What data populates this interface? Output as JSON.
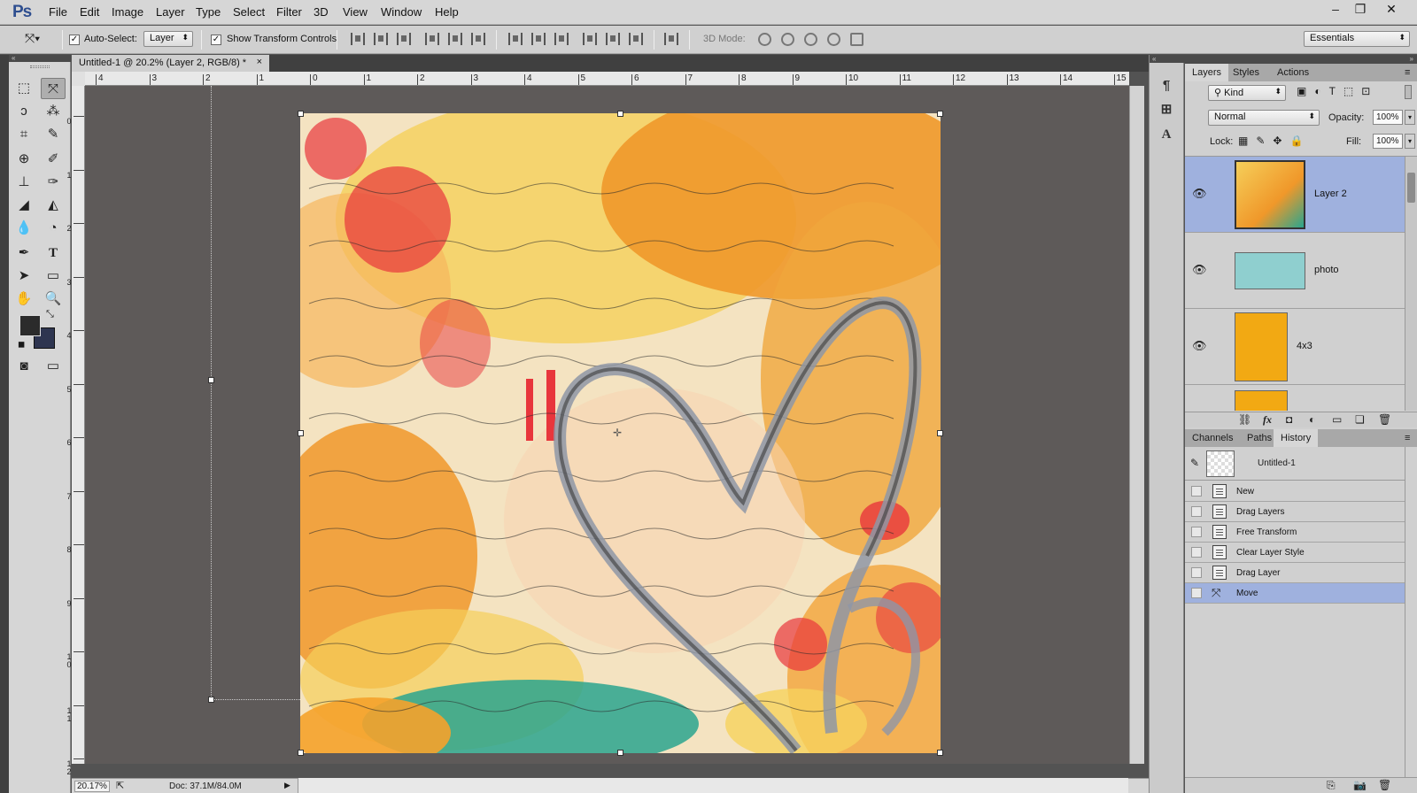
{
  "app": {
    "logo": "Ps"
  },
  "menu": [
    "File",
    "Edit",
    "Image",
    "Layer",
    "Type",
    "Select",
    "Filter",
    "3D",
    "View",
    "Window",
    "Help"
  ],
  "window_controls": {
    "minimize": "–",
    "restore": "❐",
    "close": "✕"
  },
  "options_bar": {
    "auto_select_label": "Auto-Select:",
    "auto_select_checked": true,
    "auto_select_target": "Layer",
    "show_transform_label": "Show Transform Controls",
    "show_transform_checked": true,
    "mode_3d_label": "3D Mode:",
    "workspace": "Essentials"
  },
  "document": {
    "tab_title": "Untitled-1 @ 20.2% (Layer 2, RGB/8) *",
    "tab_close": "×",
    "zoom": "20.17%",
    "doc_size": "Doc: 37.1M/84.0M"
  },
  "ruler": {
    "h_labels": [
      "4",
      "3",
      "2",
      "1",
      "0",
      "1",
      "2",
      "3",
      "4",
      "5",
      "6",
      "7",
      "8",
      "9",
      "10",
      "11",
      "12",
      "13",
      "14",
      "15"
    ],
    "v_labels": [
      "0",
      "1",
      "2",
      "3",
      "4",
      "5",
      "6",
      "7",
      "8",
      "9",
      "1\n0",
      "1\n1",
      "1\n2"
    ]
  },
  "layers_panel": {
    "tabs": [
      "Layers",
      "Styles",
      "Actions"
    ],
    "active_tab": "Layers",
    "filter_kind": "Kind",
    "blend_mode": "Normal",
    "opacity_label": "Opacity:",
    "opacity": "100%",
    "lock_label": "Lock:",
    "fill_label": "Fill:",
    "fill": "100%",
    "layers": [
      {
        "name": "Layer 2",
        "selected": true,
        "thumb_color": "#f0a63c"
      },
      {
        "name": "photo",
        "selected": false,
        "thumb_color": "#8fcfcf"
      },
      {
        "name": "4x3",
        "selected": false,
        "thumb_color": "#f2a913"
      }
    ]
  },
  "history_panel": {
    "tabs": [
      "Channels",
      "Paths",
      "History"
    ],
    "active_tab": "History",
    "snapshot": "Untitled-1",
    "states": [
      {
        "label": "New",
        "selected": false
      },
      {
        "label": "Drag Layers",
        "selected": false
      },
      {
        "label": "Free Transform",
        "selected": false
      },
      {
        "label": "Clear Layer Style",
        "selected": false
      },
      {
        "label": "Drag Layer",
        "selected": false
      },
      {
        "label": "Move",
        "selected": true
      }
    ]
  },
  "colors": {
    "selection_highlight": "#9fb1de",
    "foreground": "#2b2b2b",
    "background_swatch": "#2e3550",
    "canvas_paper": "#f4e3c1",
    "orange": "#f0982a",
    "yellow": "#f5cf5a",
    "teal": "#2aa58e",
    "red": "#e8363c",
    "heart_stroke": "#8e96a6"
  },
  "tools": [
    "marquee-tool",
    "move-tool",
    "lasso-tool",
    "quick-select-tool",
    "crop-tool",
    "eyedropper-tool",
    "healing-tool",
    "brush-tool",
    "stamp-tool",
    "history-brush-tool",
    "eraser-tool",
    "gradient-tool",
    "blur-tool",
    "dodge-tool",
    "pen-tool",
    "type-tool",
    "path-select-tool",
    "shape-tool",
    "hand-tool",
    "zoom-tool"
  ]
}
